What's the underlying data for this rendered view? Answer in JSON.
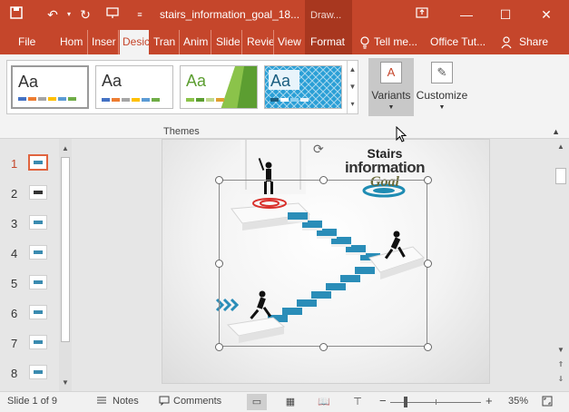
{
  "titlebar": {
    "title": "stairs_information_goal_18...",
    "context_tab": "Draw...",
    "icons": [
      "save-icon",
      "undo-icon",
      "redo-icon",
      "present-icon",
      "customize-qat-icon",
      "ribbon-display-icon",
      "minimize-icon",
      "maximize-icon",
      "close-icon"
    ]
  },
  "tabs": {
    "file": "File",
    "home": "Hom",
    "insert": "Inser",
    "design": "Desic",
    "transitions": "Tran",
    "animations": "Anim",
    "slideshow": "Slide",
    "review": "Revie",
    "view": "View",
    "format": "Format",
    "tellme": "Tell me...",
    "account": "Office Tut...",
    "share": "Share"
  },
  "ribbon": {
    "themes_label": "Themes",
    "theme_placeholder": "Aa",
    "variants_label": "Variants",
    "customize_label": "Customize"
  },
  "slides": {
    "numbers": [
      "1",
      "2",
      "3",
      "4",
      "5",
      "6",
      "7",
      "8"
    ],
    "active_index": 0
  },
  "slide": {
    "title_line1": "Stairs",
    "title_line2": "information",
    "title_line3": "Goal"
  },
  "status": {
    "slide_indicator": "Slide 1 of 9",
    "notes": "Notes",
    "comments": "Comments",
    "zoom": "35%",
    "zoom_minus": "−",
    "zoom_plus": "+"
  },
  "colors": {
    "accent": "#c5462b",
    "stairs_blue": "#2a8db8"
  }
}
